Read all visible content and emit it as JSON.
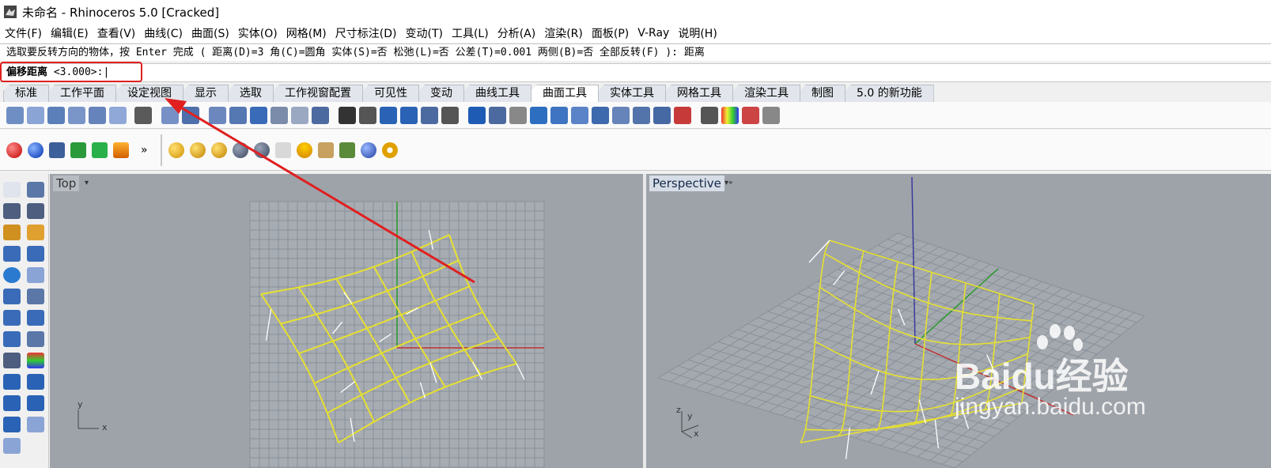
{
  "window": {
    "title": "未命名 - Rhinoceros 5.0 [Cracked]"
  },
  "menu": [
    "文件(F)",
    "编辑(E)",
    "查看(V)",
    "曲线(C)",
    "曲面(S)",
    "实体(O)",
    "网格(M)",
    "尺寸标注(D)",
    "变动(T)",
    "工具(L)",
    "分析(A)",
    "渲染(R)",
    "面板(P)",
    "V-Ray",
    "说明(H)"
  ],
  "command": {
    "history": "选取要反转方向的物体，按 Enter 完成 ( 距离(D)=3  角(C)=圆角  实体(S)=否  松弛(L)=否  公差(T)=0.001  两侧(B)=否  全部反转(F) ): 距离",
    "prompt": "偏移距离",
    "default_value": "<3.000>:"
  },
  "toolbar_tabs": [
    "标准",
    "工作平面",
    "设定视图",
    "显示",
    "选取",
    "工作视窗配置",
    "可见性",
    "变动",
    "曲线工具",
    "曲面工具",
    "实体工具",
    "网格工具",
    "渲染工具",
    "制图",
    "5.0 的新功能"
  ],
  "active_tab": "曲面工具",
  "viewports": {
    "top": {
      "label": "Top",
      "axis_x": "x",
      "axis_y": "y"
    },
    "perspective": {
      "label": "Perspective",
      "axis_x": "x",
      "axis_y": "y",
      "axis_z": "z"
    }
  },
  "watermark": {
    "brand": "Baidu经验",
    "url": "jingyan.baidu.com"
  },
  "colors": {
    "viewport_bg": "#9ea3aa",
    "grid": "#8a9097",
    "surface": "#e6e030",
    "highlight": "#e02020"
  }
}
